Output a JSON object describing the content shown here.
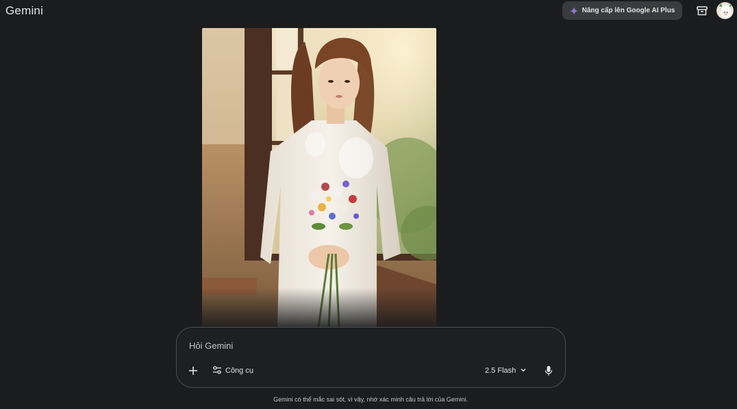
{
  "header": {
    "logo": "Gemini",
    "upgrade_label": "Nâng cấp lên Google AI Plus"
  },
  "image": {
    "alt": "Generated image"
  },
  "composer": {
    "placeholder": "Hỏi Gemini",
    "tools_label": "Công cụ",
    "model_label": "2.5 Flash"
  },
  "footer": {
    "disclaimer": "Gemini có thể mắc sai sót, vì vậy, nhớ xác minh câu trả lời của Gemini."
  },
  "colors": {
    "background": "#1b1c1d",
    "upgrade_button": "#3a3b3e",
    "text": "#e3e3e3"
  },
  "icons": [
    "gemini-spark-icon",
    "archive-icon",
    "avatar",
    "plus-icon",
    "tools-icon",
    "chevron-down-icon",
    "mic-icon"
  ]
}
